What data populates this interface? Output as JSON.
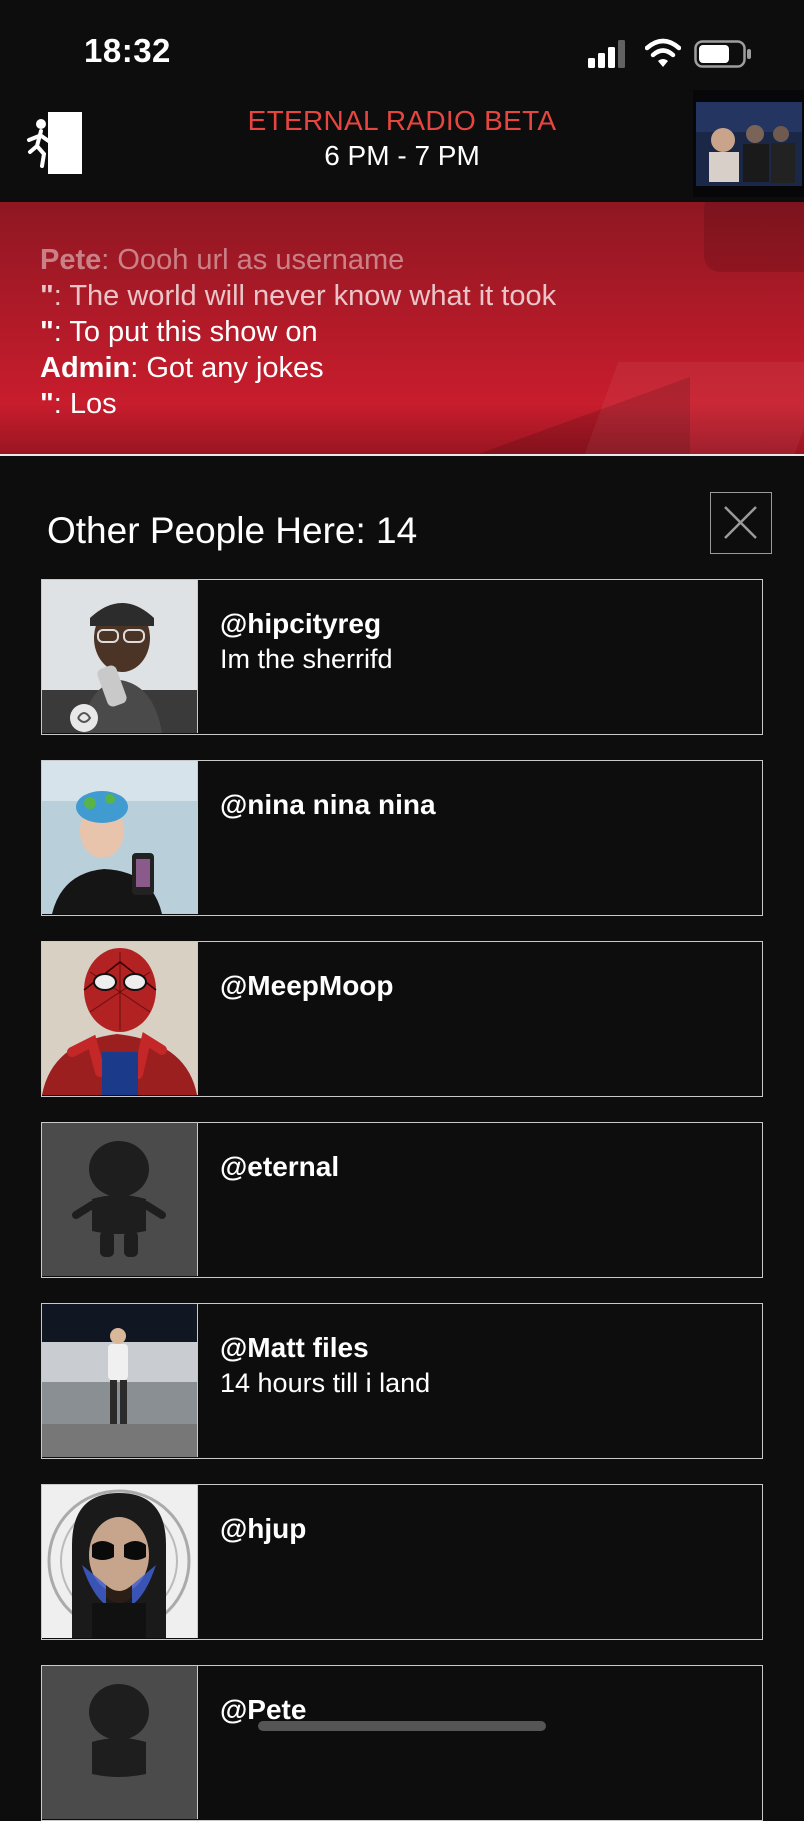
{
  "status_bar": {
    "time": "18:32"
  },
  "header": {
    "station_name": "ETERNAL RADIO BETA",
    "time_range": "6 PM - 7 PM"
  },
  "chat": {
    "messages": [
      {
        "user": "Pete",
        "text": ": Oooh url as username"
      },
      {
        "user": "\"",
        "text": ": The world will never know what it took"
      },
      {
        "user": "\"",
        "text": ": To put this show on"
      },
      {
        "user": "Admin",
        "text": ": Got any jokes"
      },
      {
        "user": "\"",
        "text": ": Los"
      }
    ]
  },
  "panel": {
    "title": "Other People Here: 14",
    "people": [
      {
        "username": "@hipcityreg",
        "status": "Im the sherrifd"
      },
      {
        "username": "@nina nina nina",
        "status": ""
      },
      {
        "username": "@MeepMoop",
        "status": ""
      },
      {
        "username": "@eternal",
        "status": ""
      },
      {
        "username": "@Matt files",
        "status": "14 hours till i land"
      },
      {
        "username": "@hjup",
        "status": ""
      },
      {
        "username": "@Pete",
        "status": ""
      }
    ]
  },
  "colors": {
    "accent": "#e6463f",
    "chat_bg": "#c01c2c",
    "background": "#0d0d0d"
  }
}
